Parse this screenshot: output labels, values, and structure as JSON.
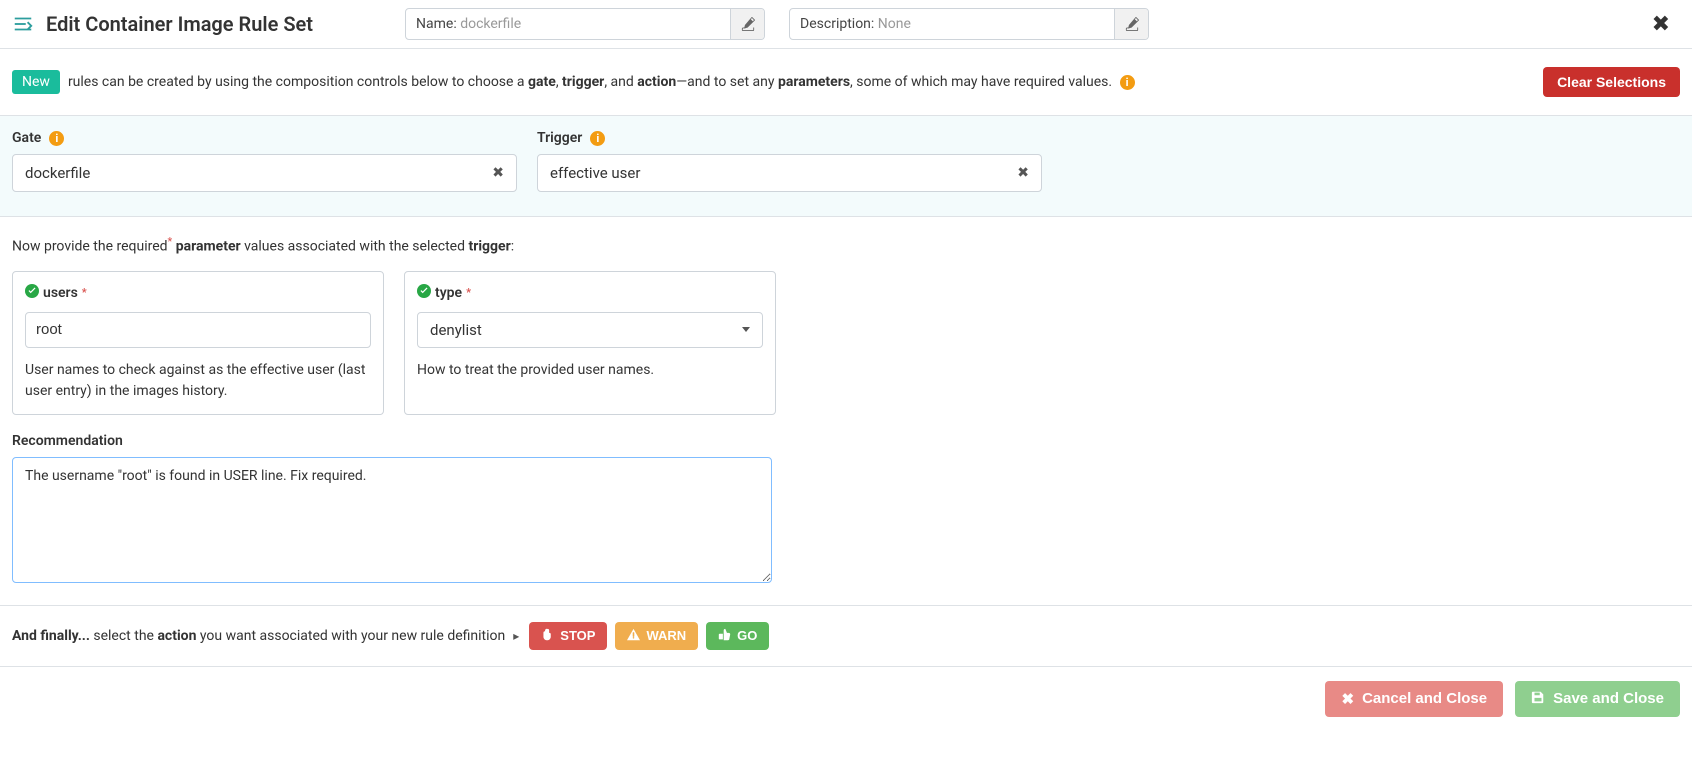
{
  "header": {
    "title": "Edit Container Image Rule Set",
    "name_label": "Name:",
    "name_value": "dockerfile",
    "desc_label": "Description:",
    "desc_value": "None"
  },
  "intro": {
    "badge": "New",
    "text_pre": " rules can be created by using the composition controls below to choose a ",
    "gate": "gate",
    "comma1": ", ",
    "trigger": "trigger",
    "and1": ", and ",
    "action": "action",
    "dash": "—and to set any ",
    "parameters": "parameters",
    "post": ", some of which may have required values.",
    "clear_button": "Clear Selections"
  },
  "gateTrigger": {
    "gate_label": "Gate",
    "gate_value": "dockerfile",
    "trigger_label": "Trigger",
    "trigger_value": "effective user"
  },
  "params": {
    "prompt_pre": "Now provide the required",
    "prompt_mid1": " parameter",
    "prompt_mid2": " values associated with the selected ",
    "prompt_trigger": "trigger",
    "prompt_post": ":",
    "users": {
      "label": "users",
      "value": "root",
      "desc": "User names to check against as the effective user (last user entry) in the images history."
    },
    "type": {
      "label": "type",
      "value": "denylist",
      "desc": "How to treat the provided user names."
    }
  },
  "recommendation": {
    "label": "Recommendation",
    "value": "The username \"root\" is found in USER line. Fix required."
  },
  "actions": {
    "pre": "And finally...",
    "mid1": " select the ",
    "action_word": "action",
    "mid2": " you want associated with your new rule definition ",
    "stop": "STOP",
    "warn": "WARN",
    "go": "GO"
  },
  "footer": {
    "cancel": "Cancel and Close",
    "save": "Save and Close"
  }
}
